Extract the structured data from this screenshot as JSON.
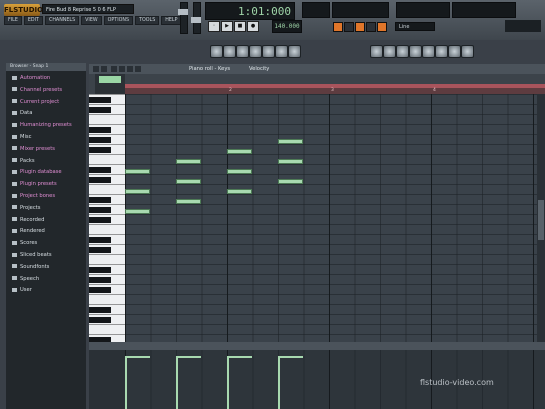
{
  "app": {
    "logo": "FLSTUDIO",
    "song_title": "Fire Bud 8 Reprise 5 0 6 FLP"
  },
  "menu": [
    "FILE",
    "EDIT",
    "CHANNELS",
    "VIEW",
    "OPTIONS",
    "TOOLS",
    "HELP"
  ],
  "transport": {
    "time": "1:01:000",
    "tempo": "140.000",
    "pattern": "Line"
  },
  "browser": {
    "header": "Browser - Snap 1",
    "items": [
      {
        "label": "Automation",
        "color": "pink"
      },
      {
        "label": "Channel presets",
        "color": "pink"
      },
      {
        "label": "Current project",
        "color": "pink"
      },
      {
        "label": "Data",
        "color": "white"
      },
      {
        "label": "Humanizing presets",
        "color": "pink"
      },
      {
        "label": "Misc",
        "color": "white"
      },
      {
        "label": "Mixer presets",
        "color": "pink"
      },
      {
        "label": "Packs",
        "color": "white"
      },
      {
        "label": "Plugin database",
        "color": "pink"
      },
      {
        "label": "Plugin presets",
        "color": "pink"
      },
      {
        "label": "Project bones",
        "color": "pink"
      },
      {
        "label": "Projects",
        "color": "white"
      },
      {
        "label": "Recorded",
        "color": "white"
      },
      {
        "label": "Rendered",
        "color": "white"
      },
      {
        "label": "Scores",
        "color": "white"
      },
      {
        "label": "Sliced beats",
        "color": "white"
      },
      {
        "label": "Soundfonts",
        "color": "white"
      },
      {
        "label": "Speech",
        "color": "white"
      },
      {
        "label": "User",
        "color": "white"
      }
    ]
  },
  "pianoroll": {
    "title": "Piano roll - Keys",
    "view": "Velocity",
    "bar_numbers": [
      "2",
      "3",
      "4"
    ],
    "notes": [
      {
        "bar": 1,
        "step": 0,
        "pitch_row": 7,
        "len": 1
      },
      {
        "bar": 1,
        "step": 0,
        "pitch_row": 9,
        "len": 1
      },
      {
        "bar": 1,
        "step": 0,
        "pitch_row": 11,
        "len": 1
      },
      {
        "bar": 1,
        "step": 2,
        "pitch_row": 6,
        "len": 1
      },
      {
        "bar": 1,
        "step": 2,
        "pitch_row": 8,
        "len": 1
      },
      {
        "bar": 1,
        "step": 2,
        "pitch_row": 10,
        "len": 1
      },
      {
        "bar": 2,
        "step": 0,
        "pitch_row": 5,
        "len": 1
      },
      {
        "bar": 2,
        "step": 0,
        "pitch_row": 7,
        "len": 1
      },
      {
        "bar": 2,
        "step": 0,
        "pitch_row": 9,
        "len": 1
      },
      {
        "bar": 2,
        "step": 2,
        "pitch_row": 4,
        "len": 1
      },
      {
        "bar": 2,
        "step": 2,
        "pitch_row": 6,
        "len": 1
      },
      {
        "bar": 2,
        "step": 2,
        "pitch_row": 8,
        "len": 1
      }
    ]
  },
  "watermark": "flstudio-video.com",
  "colors": {
    "note": "#a8d9b0",
    "ruler": "#a9545c",
    "pink_item": "#e08ed3"
  }
}
